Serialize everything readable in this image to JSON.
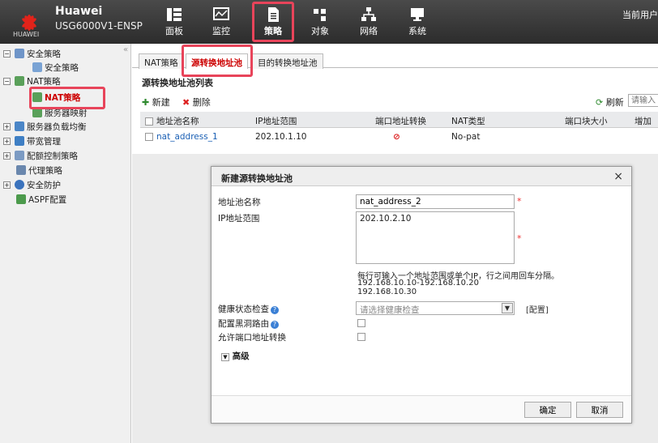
{
  "header": {
    "logo_text": "HUAWEI",
    "brand": "Huawei",
    "model": "USG6000V1-ENSP",
    "nav": [
      {
        "label": "面板",
        "icon": "dashboard-icon"
      },
      {
        "label": "监控",
        "icon": "monitor-icon"
      },
      {
        "label": "策略",
        "icon": "policy-document-icon"
      },
      {
        "label": "对象",
        "icon": "object-icon"
      },
      {
        "label": "网络",
        "icon": "network-icon"
      },
      {
        "label": "系统",
        "icon": "system-icon"
      }
    ],
    "user_label": "当前用户",
    "highlight_color": "#e8445a"
  },
  "sidebar": {
    "items": [
      {
        "label": "安全策略",
        "toggle": "−"
      },
      {
        "label": "安全策略",
        "toggle": ""
      },
      {
        "label": "NAT策略",
        "toggle": "−"
      },
      {
        "label": "NAT策略",
        "toggle": ""
      },
      {
        "label": "服务器映射",
        "toggle": ""
      },
      {
        "label": "服务器负载均衡",
        "toggle": "+"
      },
      {
        "label": "带宽管理",
        "toggle": "+"
      },
      {
        "label": "配额控制策略",
        "toggle": "+"
      },
      {
        "label": "代理策略",
        "toggle": ""
      },
      {
        "label": "安全防护",
        "toggle": "+"
      },
      {
        "label": "ASPF配置",
        "toggle": ""
      }
    ]
  },
  "main": {
    "tabs": [
      {
        "label": "NAT策略"
      },
      {
        "label": "源转换地址池"
      },
      {
        "label": "目的转换地址池"
      }
    ],
    "list_title": "源转换地址池列表",
    "toolbar": {
      "new": "新建",
      "delete": "删除",
      "refresh": "刷新",
      "search_placeholder": "请输入"
    },
    "table": {
      "headers": [
        "地址池名称",
        "IP地址范围",
        "端口地址转换",
        "NAT类型",
        "端口块大小",
        "增加"
      ],
      "rows": [
        {
          "name": "nat_address_1",
          "ip": "202.10.1.10",
          "pat": "disabled-icon",
          "nat_type": "No-pat",
          "block": ""
        }
      ]
    }
  },
  "dialog": {
    "title": "新建源转换地址池",
    "close": "×",
    "name_label": "地址池名称",
    "name_value": "nat_address_2",
    "ip_label": "IP地址范围",
    "ip_value": "202.10.2.10",
    "hint_line1": "每行可输入一个地址范围或单个IP，行之间用回车分隔。",
    "hint_line2": "192.168.10.10-192.168.10.20",
    "hint_line3": "192.168.10.30",
    "health_label": "健康状态检查",
    "health_placeholder": "请选择健康检查",
    "config_link": "[配置]",
    "blackhole_label": "配置黑洞路由",
    "pat_label": "允许端口地址转换",
    "advanced_label": "高级",
    "ok": "确定",
    "cancel": "取消",
    "required_mark": "*"
  }
}
